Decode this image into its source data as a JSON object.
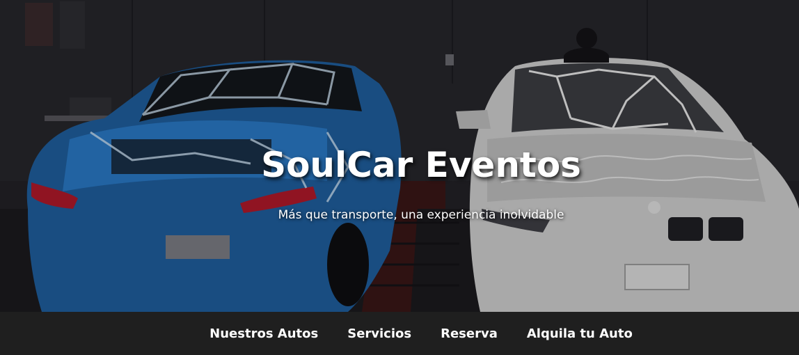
{
  "hero": {
    "title": "SoulCar Eventos",
    "subtitle": "Más que transporte, una experiencia inolvidable"
  },
  "nav": {
    "items": [
      {
        "label": "Nuestros Autos"
      },
      {
        "label": "Servicios"
      },
      {
        "label": "Reserva"
      },
      {
        "label": "Alquila tu Auto"
      }
    ]
  },
  "colors": {
    "nav_background": "#1f1f1f",
    "text": "#ffffff",
    "blue_car": "#1f6fb8",
    "white_car": "#d9d9d9"
  }
}
